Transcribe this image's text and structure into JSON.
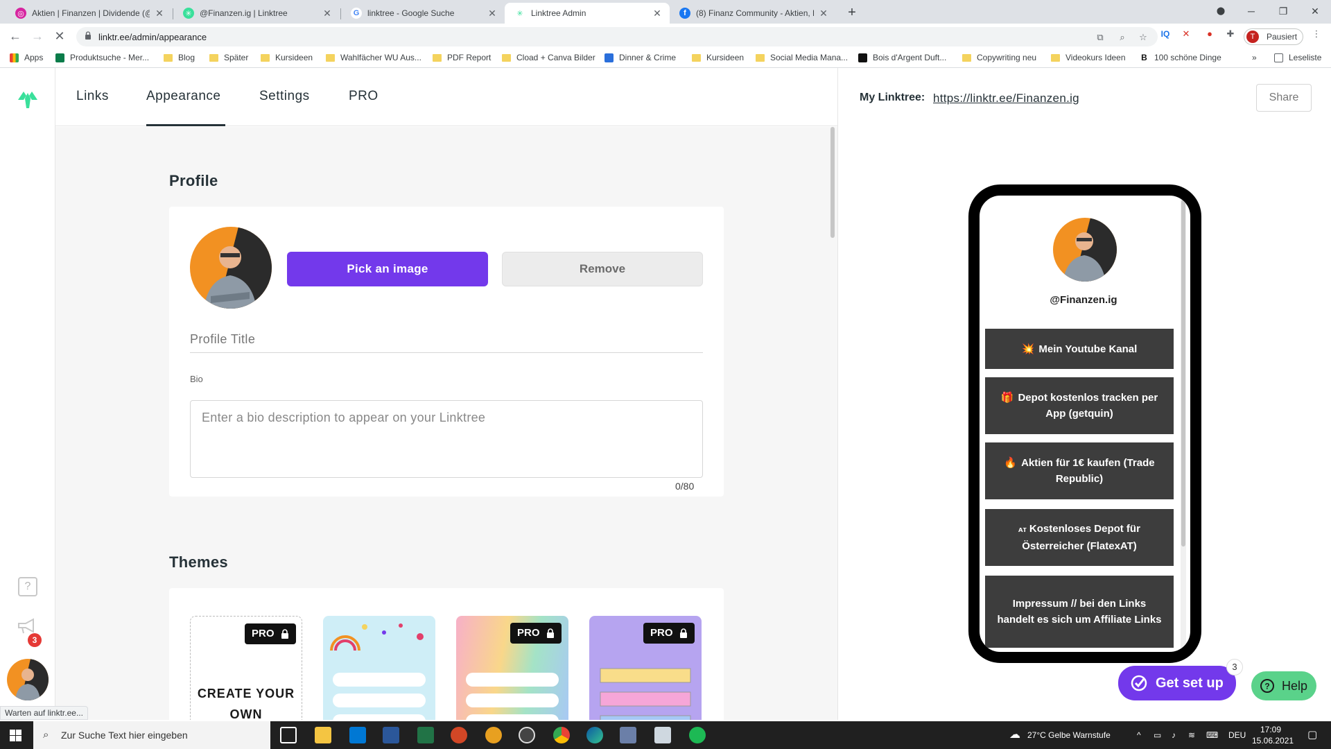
{
  "browser": {
    "tabs": [
      {
        "title": "Aktien | Finanzen | Dividende (@",
        "fav_color": "#d6249f",
        "fav_glyph": "◎",
        "icon": "instagram-icon",
        "active": false
      },
      {
        "title": "@Finanzen.ig | Linktree",
        "fav_color": "#39e09b",
        "fav_glyph": "✳",
        "icon": "linktree-icon",
        "active": false
      },
      {
        "title": "linktree - Google Suche",
        "fav_color": "#4285f4",
        "fav_glyph": "G",
        "icon": "google-icon",
        "active": false
      },
      {
        "title": "Linktree Admin",
        "fav_color": "#39e09b",
        "fav_glyph": "✳",
        "icon": "linktree-icon",
        "active": true
      },
      {
        "title": "(8) Finanz Community - Aktien, D",
        "fav_color": "#1877f2",
        "fav_glyph": "f",
        "icon": "facebook-icon",
        "active": false
      }
    ],
    "url": "linktr.ee/admin/appearance",
    "profile_label": "Pausiert",
    "profile_initial": "T",
    "bookmarks": [
      {
        "label": "Apps",
        "kind": "apps"
      },
      {
        "label": "Produktsuche - Mer...",
        "kind": "site"
      },
      {
        "label": "Blog",
        "kind": "folder"
      },
      {
        "label": "Später",
        "kind": "folder"
      },
      {
        "label": "Kursideen",
        "kind": "folder"
      },
      {
        "label": "Wahlfächer WU Aus...",
        "kind": "folder"
      },
      {
        "label": "PDF Report",
        "kind": "folder"
      },
      {
        "label": "Cload + Canva Bilder",
        "kind": "folder"
      },
      {
        "label": "Dinner & Crime",
        "kind": "site"
      },
      {
        "label": "Kursideen",
        "kind": "folder"
      },
      {
        "label": "Social Media Mana...",
        "kind": "folder"
      },
      {
        "label": "Bois d'Argent Duft...",
        "kind": "site"
      },
      {
        "label": "Copywriting neu",
        "kind": "folder"
      },
      {
        "label": "Videokurs Ideen",
        "kind": "folder"
      },
      {
        "label": "100 schöne Dinge",
        "kind": "site"
      }
    ],
    "reading_list": "Leseliste",
    "status_text": "Warten auf linktr.ee..."
  },
  "nav": {
    "links": "Links",
    "appearance": "Appearance",
    "settings": "Settings",
    "pro": "PRO"
  },
  "sidebar": {
    "notifications_count": "3"
  },
  "profile": {
    "section_title": "Profile",
    "pick_image": "Pick an image",
    "remove": "Remove",
    "title_placeholder": "Profile Title",
    "bio_label": "Bio",
    "bio_placeholder": "Enter a bio description to appear on your Linktree",
    "bio_counter": "0/80"
  },
  "themes": {
    "section_title": "Themes",
    "pro_label": "PRO",
    "create_own": "CREATE YOUR OWN"
  },
  "preview": {
    "my_linktree_label": "My Linktree:",
    "url": "https://linktr.ee/Finanzen.ig",
    "share": "Share",
    "handle": "@Finanzen.ig",
    "links": [
      {
        "emoji": "💥",
        "text": "Mein Youtube Kanal"
      },
      {
        "emoji": "🎁",
        "text": "Depot kostenlos tracken per App (getquin)"
      },
      {
        "emoji": "🔥",
        "text": "Aktien für 1€ kaufen (Trade Republic)"
      },
      {
        "emoji": "ᴀᴛ",
        "text": "Kostenloses Depot für Österreicher (FlatexAT)"
      },
      {
        "emoji": "",
        "text": "Impressum // bei den Links handelt es sich um Affiliate Links"
      }
    ]
  },
  "floating": {
    "get_set_up": "Get set up",
    "get_set_up_count": "3",
    "help": "Help"
  },
  "taskbar": {
    "search_placeholder": "Zur Suche Text hier eingeben",
    "weather": "27°C Gelbe Warnstufe",
    "language": "DEU",
    "time": "17:09",
    "date": "15.06.2021"
  },
  "colors": {
    "accent": "#7339eb",
    "help_green": "#5ad28a",
    "link_button": "#3d3d3d",
    "linktree_green": "#39e09b"
  }
}
